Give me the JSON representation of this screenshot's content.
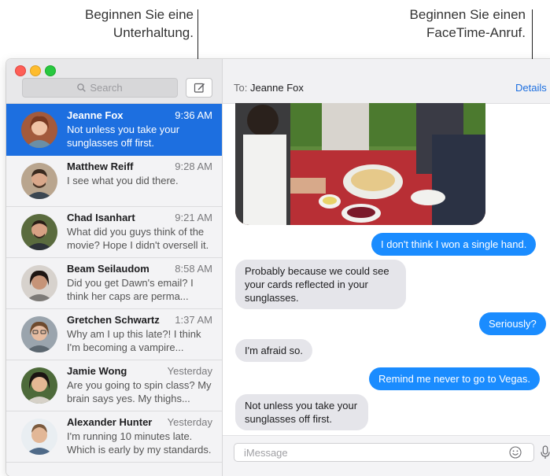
{
  "callouts": {
    "compose_line1": "Beginnen Sie eine",
    "compose_line2": "Unterhaltung.",
    "facetime_line1": "Beginnen Sie einen",
    "facetime_line2": "FaceTime-Anruf."
  },
  "sidebar": {
    "search_placeholder": "Search",
    "conversations": [
      {
        "name": "Jeanne Fox",
        "time": "9:36 AM",
        "preview": "Not unless you take your sunglasses off first.",
        "selected": true
      },
      {
        "name": "Matthew Reiff",
        "time": "9:28 AM",
        "preview": "I see what you did there."
      },
      {
        "name": "Chad Isanhart",
        "time": "9:21 AM",
        "preview": "What did you guys think of the movie? Hope I didn't oversell it."
      },
      {
        "name": "Beam Seilaudom",
        "time": "8:58 AM",
        "preview": "Did you get Dawn's email? I think her caps are perma..."
      },
      {
        "name": "Gretchen Schwartz",
        "time": "1:37 AM",
        "preview": "Why am I up this late?! I think I'm becoming a vampire..."
      },
      {
        "name": "Jamie Wong",
        "time": "Yesterday",
        "preview": "Are you going to spin class? My brain says yes. My thighs..."
      },
      {
        "name": "Alexander Hunter",
        "time": "Yesterday",
        "preview": "I'm running 10 minutes late. Which is early by my standards."
      }
    ]
  },
  "main": {
    "to_prefix": "To:",
    "recipient": "Jeanne Fox",
    "details_label": "Details",
    "messages": [
      {
        "dir": "out",
        "text": "I don't think I won a single hand."
      },
      {
        "dir": "in",
        "text": "Probably because we could see your cards reflected in your sunglasses."
      },
      {
        "dir": "out",
        "text": "Seriously?"
      },
      {
        "dir": "in",
        "text": "I'm afraid so."
      },
      {
        "dir": "out",
        "text": "Remind me never to go to Vegas."
      },
      {
        "dir": "in",
        "text": "Not unless you take your sunglasses off first."
      }
    ],
    "input_placeholder": "iMessage"
  },
  "colors": {
    "accent": "#1d6fe0",
    "bubble_out": "#1a8cff",
    "bubble_in": "#e5e5ea"
  }
}
